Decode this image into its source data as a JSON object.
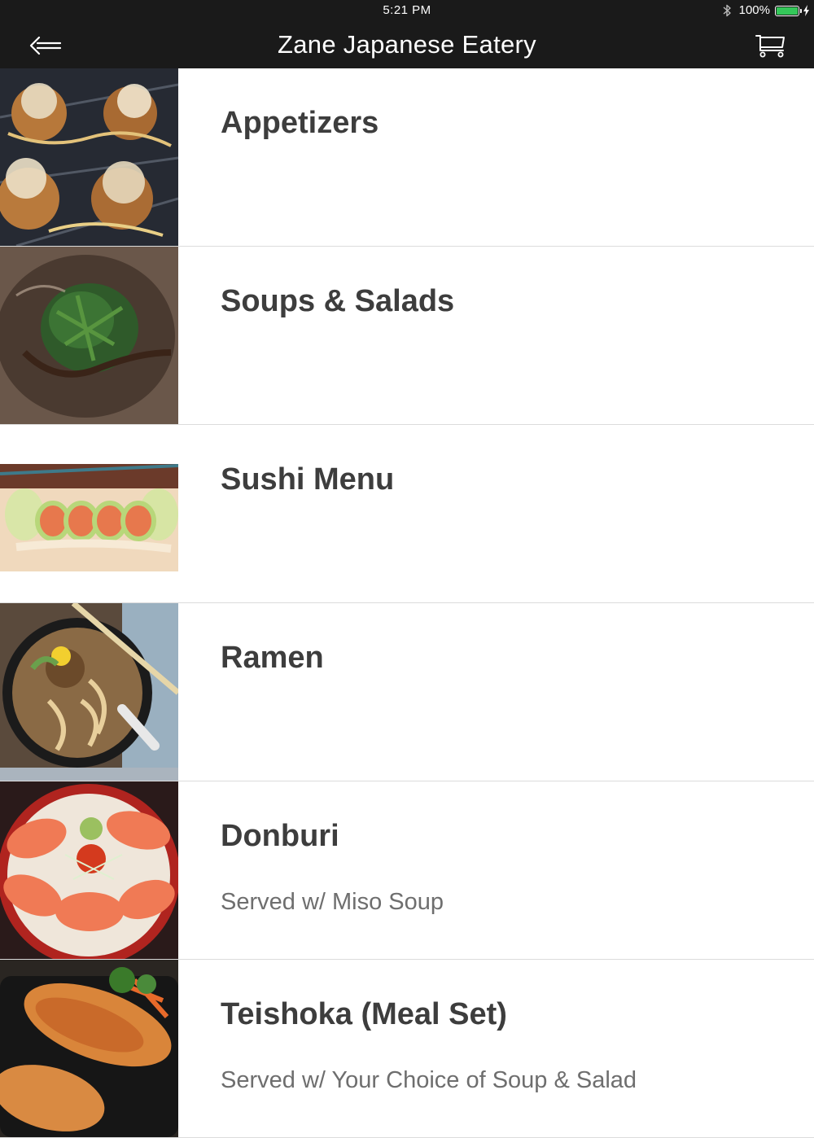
{
  "status_bar": {
    "time": "5:21 PM",
    "battery_percent": "100%",
    "battery_level": 1.0,
    "battery_color": "#34c759",
    "icons": [
      "bluetooth-icon",
      "battery-icon",
      "charging-bolt-icon"
    ]
  },
  "nav": {
    "title": "Zane Japanese Eatery",
    "back_icon": "back-arrow-icon",
    "cart_icon": "shopping-cart-icon"
  },
  "categories": [
    {
      "name": "Appetizers",
      "subtitle": "",
      "image": "takoyaki-photo"
    },
    {
      "name": "Soups & Salads",
      "subtitle": "",
      "image": "seaweed-salad-photo"
    },
    {
      "name": "Sushi Menu",
      "subtitle": "",
      "image": "sushi-roll-photo"
    },
    {
      "name": "Ramen",
      "subtitle": "",
      "image": "ramen-bowl-photo"
    },
    {
      "name": "Donburi",
      "subtitle": "Served w/ Miso Soup",
      "image": "salmon-donburi-photo"
    },
    {
      "name": "Teishoka (Meal Set)",
      "subtitle": "Served w/ Your Choice of Soup & Salad",
      "image": "grilled-salmon-photo"
    }
  ],
  "colors": {
    "bar_background": "#1a1a1a",
    "title_text": "#3d3d3d",
    "subtitle_text": "#6e6e6e",
    "divider": "#dcdcdc"
  }
}
